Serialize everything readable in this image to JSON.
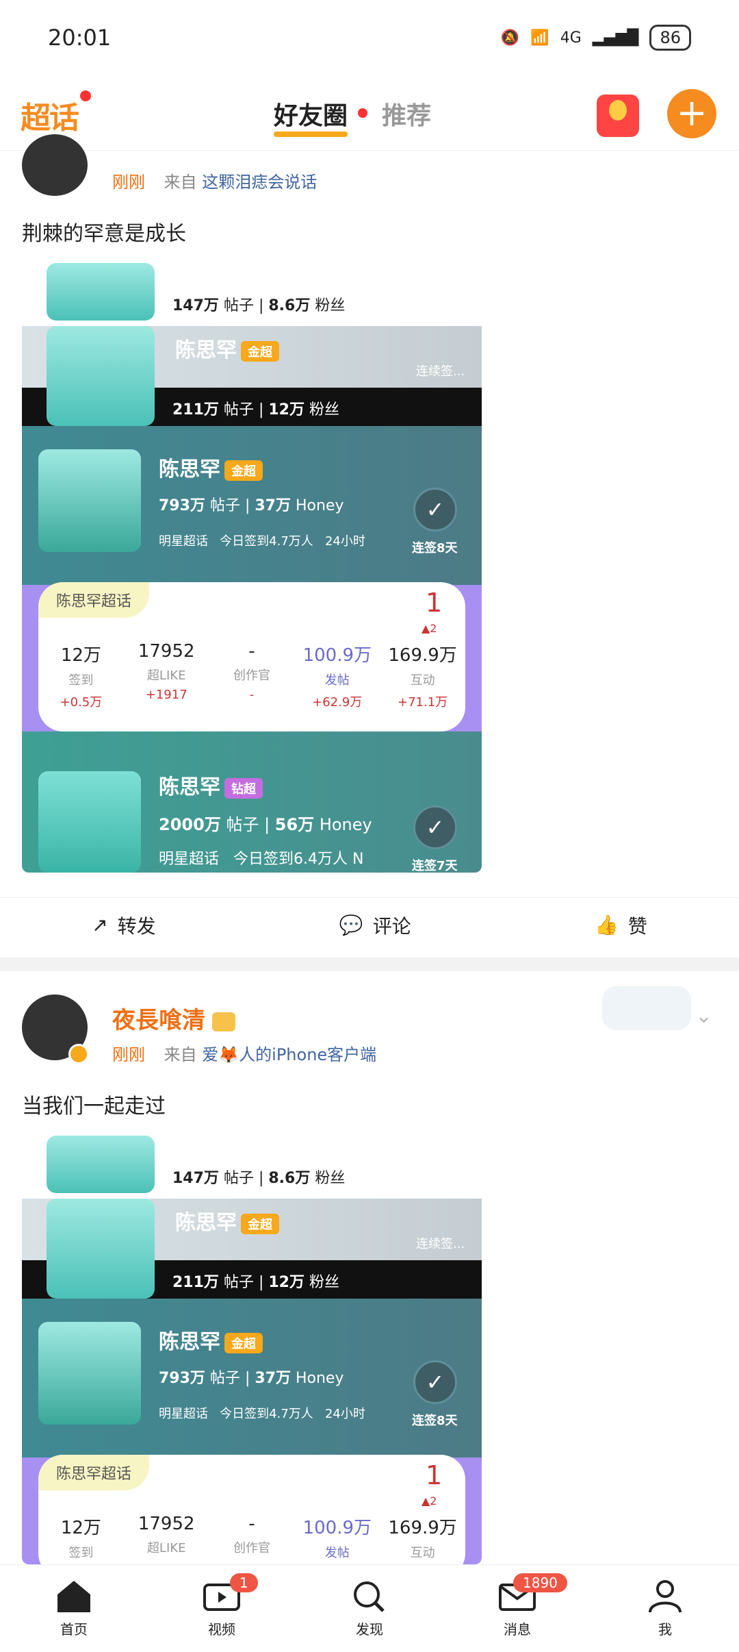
{
  "status": {
    "time": "20:01",
    "battery": "86",
    "network": "4G"
  },
  "header": {
    "logo": "超话",
    "tabs": [
      "好友圈",
      "推荐"
    ]
  },
  "post1": {
    "author": "",
    "time": "刚刚",
    "from_prefix": "来自",
    "source": "这颗泪痣会说话",
    "content": "荆棘的罕意是成长",
    "card": {
      "row1": {
        "posts": "147万",
        "posts_label": "帖子",
        "fans": "8.6万",
        "fans_label": "粉丝"
      },
      "row2": {
        "name": "陈思罕",
        "badge": "金超",
        "posts": "211万",
        "posts_label": "帖子",
        "fans": "12万",
        "fans_label": "粉丝",
        "checkin": "连续签..."
      },
      "row3": {
        "name": "陈思罕",
        "badge": "金超",
        "posts": "793万",
        "posts_label": "帖子",
        "honey": "37万",
        "honey_label": "Honey",
        "tag1": "明星超话",
        "tag2": "今日签到4.7万人",
        "tag3": "24小时",
        "checkin": "连签8天"
      },
      "panel": {
        "label": "陈思罕超话",
        "rank": "1",
        "rank_change": "▲2",
        "stats": [
          {
            "value": "12万",
            "label": "签到",
            "delta": "+0.5万"
          },
          {
            "value": "17952",
            "label": "超LIKE",
            "delta": "+1917"
          },
          {
            "value": "-",
            "label": "创作官",
            "delta": "-"
          },
          {
            "value": "100.9万",
            "label": "发帖",
            "delta": "+62.9万"
          },
          {
            "value": "169.9万",
            "label": "互动",
            "delta": "+71.1万"
          }
        ]
      },
      "row4": {
        "name": "陈思罕",
        "badge": "钻超",
        "posts": "2000万",
        "posts_label": "帖子",
        "honey": "56万",
        "honey_label": "Honey",
        "tag1": "明星超话",
        "tag2": "今日签到6.4万人 N",
        "checkin": "连签7天"
      }
    },
    "actions": {
      "repost": "转发",
      "comment": "评论",
      "like": "赞"
    }
  },
  "post2": {
    "author": "夜長喰清",
    "time": "刚刚",
    "from_prefix": "来自",
    "source": "爱🦊人的iPhone客户端",
    "content": "当我们一起走过",
    "card": {
      "row1": {
        "posts": "147万",
        "posts_label": "帖子",
        "fans": "8.6万",
        "fans_label": "粉丝"
      },
      "row2": {
        "name": "陈思罕",
        "badge": "金超",
        "posts": "211万",
        "posts_label": "帖子",
        "fans": "12万",
        "fans_label": "粉丝",
        "checkin": "连续签..."
      },
      "row3": {
        "name": "陈思罕",
        "badge": "金超",
        "posts": "793万",
        "posts_label": "帖子",
        "honey": "37万",
        "honey_label": "Honey",
        "tag1": "明星超话",
        "tag2": "今日签到4.7万人",
        "tag3": "24小时",
        "checkin": "连签8天"
      },
      "panel": {
        "label": "陈思罕超话",
        "rank": "1",
        "rank_change": "▲2",
        "stats": [
          {
            "value": "12万",
            "label": "签到"
          },
          {
            "value": "17952",
            "label": "超LIKE"
          },
          {
            "value": "-",
            "label": "创作官"
          },
          {
            "value": "100.9万",
            "label": "发帖"
          },
          {
            "value": "169.9万",
            "label": "互动"
          }
        ]
      }
    }
  },
  "bottom_nav": [
    {
      "label": "首页"
    },
    {
      "label": "视频",
      "badge": "1"
    },
    {
      "label": "发现"
    },
    {
      "label": "消息",
      "badge": "1890"
    },
    {
      "label": "我"
    }
  ]
}
